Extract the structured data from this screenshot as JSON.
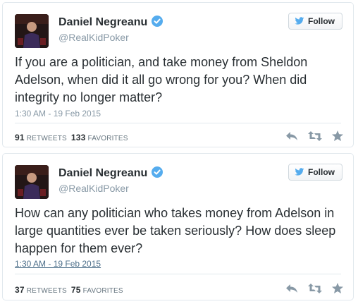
{
  "tweets": [
    {
      "name": "Daniel Negreanu",
      "handle": "@RealKidPoker",
      "follow_label": "Follow",
      "text": "If you are a politician, and take money from Sheldon Adelson, when did it all go wrong for you? When did integrity no longer matter?",
      "timestamp": "1:30 AM - 19 Feb 2015",
      "retweets": "91",
      "retweets_label": "RETWEETS",
      "favorites": "133",
      "favorites_label": "FAVORITES"
    },
    {
      "name": "Daniel Negreanu",
      "handle": "@RealKidPoker",
      "follow_label": "Follow",
      "text": "How can any politician who takes money from Adelson in large quantities ever be taken seriously? How does sleep happen for them ever?",
      "timestamp": "1:30 AM - 19 Feb 2015",
      "retweets": "37",
      "retweets_label": "RETWEETS",
      "favorites": "75",
      "favorites_label": "FAVORITES"
    }
  ],
  "colors": {
    "verified": "#55acee",
    "twitter_blue": "#55acee",
    "icon_gray": "#8899a6"
  },
  "icons": [
    "verified-badge-icon",
    "twitter-bird-icon",
    "reply-icon",
    "retweet-icon",
    "favorite-star-icon"
  ]
}
